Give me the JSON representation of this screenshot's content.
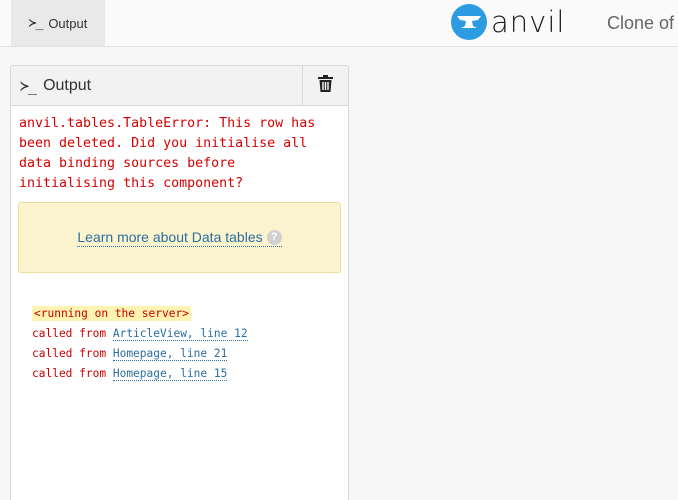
{
  "topbar": {
    "tab_prompt_glyph": "≻_",
    "tab_label": "Output",
    "logo_text": "anvil",
    "clone_text": "Clone of"
  },
  "panel": {
    "prompt_glyph": "≻_",
    "title": "Output",
    "error_lines": [
      "anvil.tables.TableError: This row has",
      "been deleted. Did you initialise all",
      "data binding sources before",
      "initialising this component?"
    ],
    "learn_more_link": "Learn more about Data tables",
    "help_icon": "?",
    "traceback": {
      "server_note": "<running on the server>",
      "called_from_label": "called from",
      "frames": [
        {
          "location": "ArticleView, line 12"
        },
        {
          "location": "Homepage, line 21"
        },
        {
          "location": "Homepage, line 15"
        }
      ]
    }
  },
  "colors": {
    "error": "#d60000",
    "link": "#2b6ea0",
    "logo_circle": "#2d9be2",
    "info_box_bg": "#fbf4cf",
    "server_note_bg": "#fff3b0"
  },
  "icons": [
    "terminal-prompt-icon",
    "anvil-logo-icon",
    "trash-icon",
    "help-icon"
  ]
}
